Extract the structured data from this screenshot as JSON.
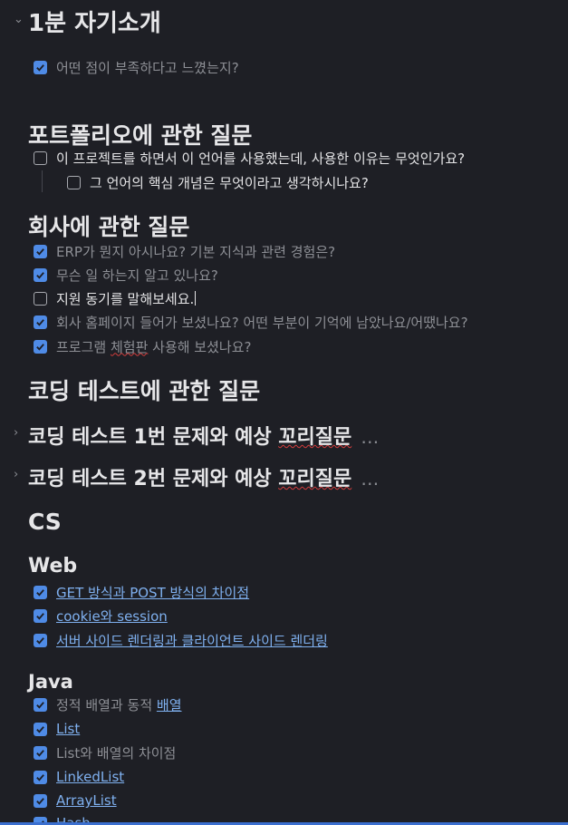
{
  "section1": {
    "title": "1분 자기소개",
    "items": [
      {
        "text": "어떤 점이 부족하다고 느꼈는지?",
        "checked": true
      }
    ]
  },
  "section2": {
    "title": "포트폴리오에 관한 질문",
    "items": [
      {
        "text": "이 프로젝트를 하면서 이 언어를 사용했는데, 사용한 이유는 무엇인가요?",
        "checked": false
      },
      {
        "text": "그 언어의 핵심 개념은 무엇이라고 생각하시나요?",
        "checked": false
      }
    ]
  },
  "section3": {
    "title": "회사에 관한 질문",
    "items": [
      {
        "text": "ERP가 뭔지 아시나요? 기본 지식과 관련 경험은?",
        "checked": true
      },
      {
        "text": "무슨 일 하는지 알고 있나요?",
        "checked": true
      },
      {
        "text": "지원 동기를 말해보세요.",
        "checked": false
      },
      {
        "text": "회사 홈페이지 들어가 보셨나요? 어떤 부분이 기억에 남았나요/어땠나요?",
        "checked": true
      },
      {
        "text_a": "프로그램 ",
        "text_b": "체험판",
        "text_c": " 사용해 보셨나요?",
        "checked": true
      }
    ]
  },
  "section4": {
    "title": "코딩 테스트에 관한 질문",
    "sub1_a": "코딩 테스트 1번 문제와 예상 ",
    "sub1_b": "꼬리질문",
    "sub2_a": "코딩 테스트 2번 문제와 예상 ",
    "sub2_b": "꼬리질문",
    "ellipsis": "…"
  },
  "cs": {
    "title": "CS"
  },
  "web": {
    "title": "Web",
    "items": [
      {
        "text": "GET 방식과 POST 방식의 차이점",
        "checked": true
      },
      {
        "text": "cookie와 session",
        "checked": true
      },
      {
        "text": "서버 사이드 렌더링과 클라이언트 사이드 렌더링",
        "checked": true
      }
    ]
  },
  "java": {
    "title": "Java",
    "items": [
      {
        "text_a": "정적 배열과 동적 ",
        "text_b": "배열",
        "checked": true
      },
      {
        "text": "List",
        "checked": true
      },
      {
        "text": "List와 배열의 차이점",
        "checked": true
      },
      {
        "text": "LinkedList",
        "checked": true
      },
      {
        "text": "ArrayList",
        "checked": true
      },
      {
        "text": "Hash",
        "checked": true
      }
    ]
  },
  "colors": {
    "accent": "#4f8be6",
    "link": "#7fb0ef",
    "background": "#1e1f25"
  },
  "icons": {
    "fold_open": "chevron-down-icon",
    "fold_closed": "chevron-right-icon",
    "checkbox": "check-icon"
  }
}
